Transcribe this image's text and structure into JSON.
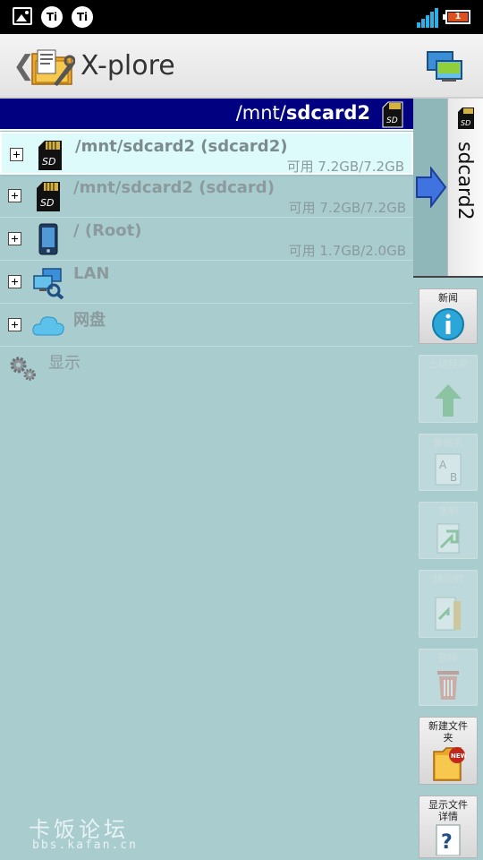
{
  "status_bar": {
    "ti_label": "Ti",
    "battery_level": "1",
    "icons": [
      "image-icon",
      "ti-icon",
      "ti-icon",
      "signal-icon",
      "battery-icon"
    ]
  },
  "title_bar": {
    "app_title": "X-plore",
    "back_glyph": "❮",
    "icons": [
      "back-icon",
      "app-icon",
      "screens-icon"
    ]
  },
  "path_header": {
    "prefix": "/mnt/",
    "bold": "sdcard2"
  },
  "tree": {
    "items": [
      {
        "label": "/mnt/sdcard2 (sdcard2)",
        "sub": "可用 7.2GB/7.2GB",
        "icon": "sd-card-icon",
        "selected": true
      },
      {
        "label": "/mnt/sdcard2 (sdcard)",
        "sub": "可用 7.2GB/7.2GB",
        "icon": "sd-card-icon"
      },
      {
        "label": "/ (Root)",
        "sub": "可用 1.7GB/2.0GB",
        "icon": "phone-icon"
      },
      {
        "label": "LAN",
        "icon": "lan-icon"
      },
      {
        "label": "网盘",
        "icon": "cloud-icon"
      },
      {
        "label": "显示",
        "icon": "gears-icon"
      }
    ]
  },
  "side_tab": {
    "label": "sdcard2"
  },
  "side_buttons": [
    {
      "label": "新闻",
      "icon": "info-icon",
      "enabled": true
    },
    {
      "label": "上级目录",
      "icon": "up-arrow-icon",
      "enabled": false
    },
    {
      "label": "重命名",
      "icon": "rename-icon",
      "enabled": false
    },
    {
      "label": "复制",
      "icon": "copy-icon",
      "enabled": false
    },
    {
      "label": "移动到",
      "icon": "move-icon",
      "enabled": false
    },
    {
      "label": "删除",
      "icon": "trash-icon",
      "enabled": false
    },
    {
      "label": "新建文件夹",
      "icon": "new-folder-icon",
      "enabled": true
    },
    {
      "label": "显示文件详情",
      "icon": "help-icon",
      "enabled": true
    }
  ],
  "watermark": {
    "main": "卡饭论坛",
    "sub": "bbs.kafan.cn"
  }
}
